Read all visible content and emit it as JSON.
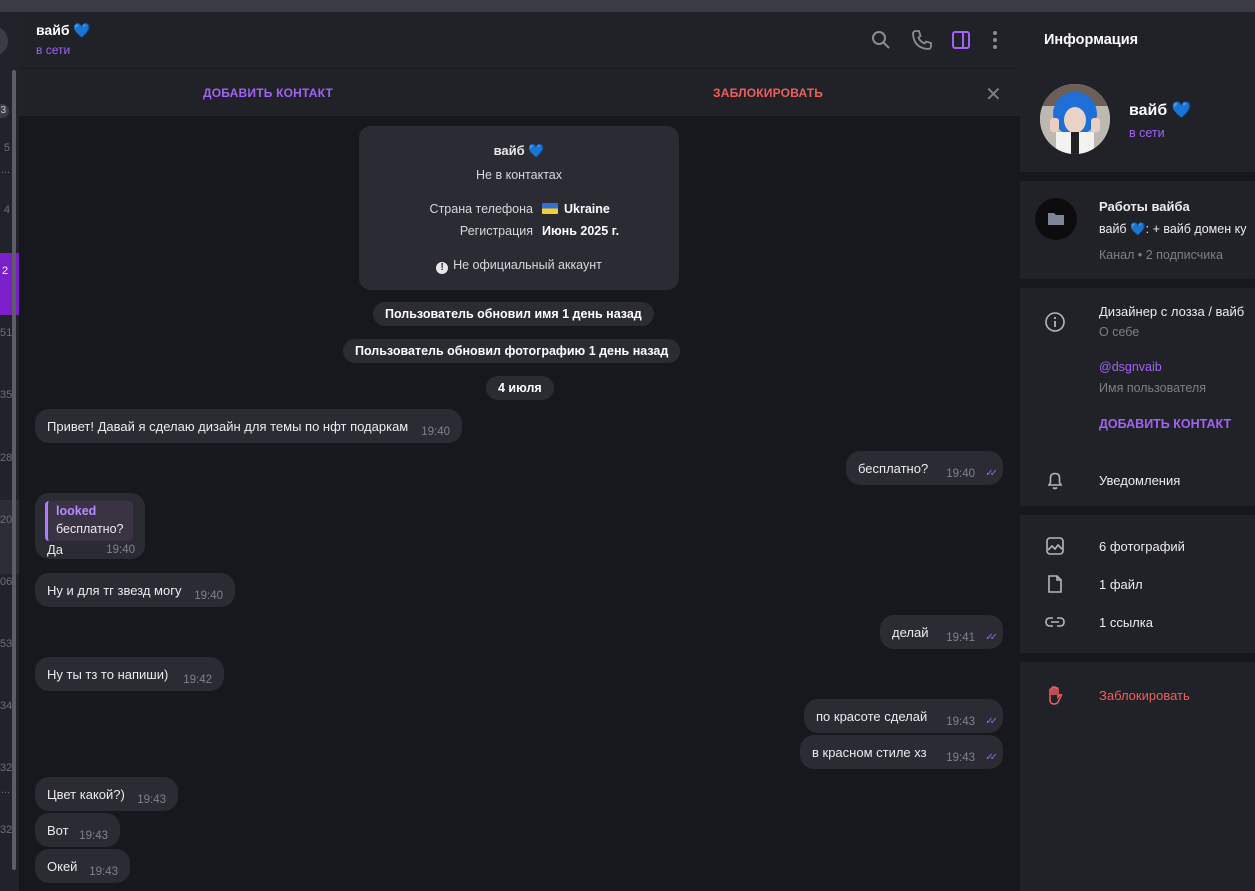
{
  "chat": {
    "name": "вайб 💙",
    "status": "в сети",
    "actions": {
      "add_contact": "ДОБАВИТЬ КОНТАКТ",
      "block": "ЗАБЛОКИРОВАТЬ",
      "close": "✕"
    }
  },
  "left_list": {
    "badge": "3",
    "numbers": [
      "5",
      "...",
      "4",
      "2",
      "51",
      "35",
      "28",
      "20",
      "06",
      "53",
      "34",
      "32",
      "...",
      "32"
    ]
  },
  "info_card": {
    "name": "вайб 💙",
    "subtitle": "Не в контактах",
    "phone_country_label": "Страна телефона",
    "phone_country_value": "Ukraine",
    "registration_label": "Регистрация",
    "registration_value": "Июнь 2025 г.",
    "unofficial": "Не официальный аккаунт"
  },
  "service": {
    "name_update": "Пользователь обновил имя 1 день назад",
    "photo_update": "Пользователь обновил фотографию 1 день назад",
    "date": "4 июля"
  },
  "messages": [
    {
      "dir": "in",
      "text": "Привет! Давай я сделаю дизайн для темы по нфт подаркам",
      "time": "19:40"
    },
    {
      "dir": "out",
      "text": "бесплатно?",
      "time": "19:40"
    },
    {
      "dir": "in",
      "text": "Ну и для тг звезд могу",
      "time": "19:40"
    },
    {
      "dir": "out",
      "text": "делай",
      "time": "19:41"
    },
    {
      "dir": "in",
      "text": "Ну ты тз то напиши)",
      "time": "19:42"
    },
    {
      "dir": "out",
      "text": "по красоте сделай",
      "time": "19:43"
    },
    {
      "dir": "out",
      "text": "в красном стиле хз",
      "time": "19:43"
    },
    {
      "dir": "in",
      "text": "Цвет какой?)",
      "time": "19:43"
    },
    {
      "dir": "in",
      "text": "Вот",
      "time": "19:43"
    },
    {
      "dir": "in",
      "text": "Окей",
      "time": "19:43"
    }
  ],
  "reply_msg": {
    "quote_name": "looked",
    "quote_text": "бесплатно?",
    "text": "Да",
    "time": "19:40"
  },
  "info_panel": {
    "title": "Информация",
    "name": "вайб 💙",
    "status": "в сети",
    "channel_name": "Работы вайба",
    "channel_preview": "вайб 💙: + вайб домен ку",
    "channel_meta": "Канал • 2 подписчика",
    "bio": "Дизайнер с лозза / вайб",
    "bio_label": "О себе",
    "username": "@dsgnvaib",
    "username_label": "Имя пользователя",
    "add_contact": "ДОБАВИТЬ КОНТАКТ",
    "notifications": "Уведомления",
    "photos": "6 фотографий",
    "files": "1 файл",
    "links": "1 ссылка",
    "block": "Заблокировать"
  },
  "colors": {
    "accent": "#a063f4",
    "danger": "#ee5f5f",
    "bubble": "#2a2b33",
    "panel": "#212228",
    "background": "#17181e"
  }
}
